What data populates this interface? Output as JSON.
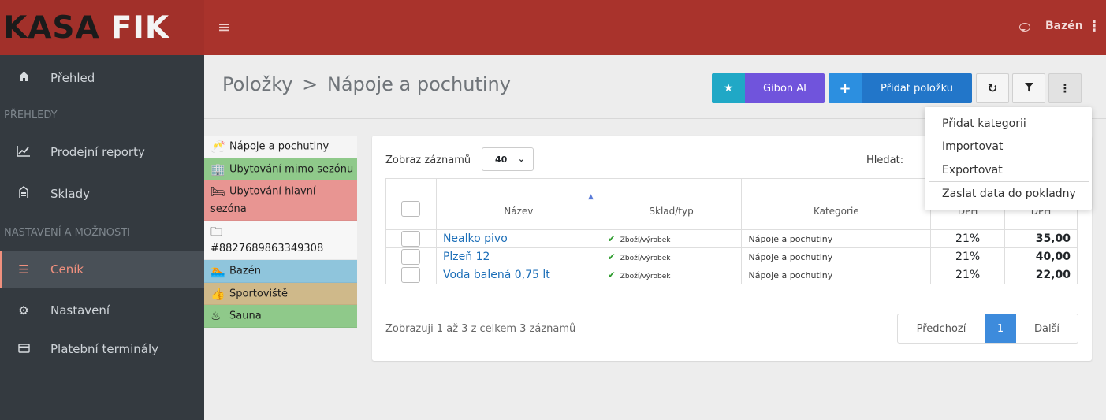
{
  "app": {
    "logo_a": "KASA",
    "logo_b": "FIK",
    "user": "Bazén"
  },
  "sidebar": {
    "items": [
      {
        "label": "Přehled",
        "icon": "home-icon"
      },
      {
        "label": "Prodejní reporty",
        "icon": "chart-icon"
      },
      {
        "label": "Sklady",
        "icon": "warehouse-icon"
      },
      {
        "label": "Ceník",
        "icon": "list-icon"
      },
      {
        "label": "Nastavení",
        "icon": "gear-icon"
      },
      {
        "label": "Platební terminály",
        "icon": "card-icon"
      }
    ],
    "section_prehledy": "PŘEHLEDY",
    "section_nastaveni": "NASTAVENÍ A MOŽNOSTI"
  },
  "breadcrumb": {
    "root": "Položky",
    "separator": ">",
    "current": "Nápoje a pochutiny"
  },
  "toolbar": {
    "gibon": "Gibon AI",
    "add": "Přidat položku"
  },
  "categories": [
    {
      "label": "Nápoje a pochutiny",
      "icon": "cheers-icon",
      "color": "#f5f5f5"
    },
    {
      "label": "Ubytování mimo sezónu",
      "icon": "building-icon",
      "color": "#8fc98a"
    },
    {
      "label": "Ubytování hlavní sezóna",
      "icon": "bed-icon",
      "color": "#e89592"
    },
    {
      "label": "#8827689863349308",
      "icon": "folder-icon",
      "color": "#f7f7f7"
    },
    {
      "label": "Bazén",
      "icon": "swimmer-icon",
      "color": "#8fc5dc"
    },
    {
      "label": "Sportoviště",
      "icon": "thumbs-up-icon",
      "color": "#cfb98a"
    },
    {
      "label": "Sauna",
      "icon": "sauna-icon",
      "color": "#8fc98a"
    }
  ],
  "table": {
    "length_label": "Zobraz záznamů",
    "length_value": "40",
    "search_label": "Hledat:",
    "columns": [
      "Název",
      "Sklad/typ",
      "Kategorie",
      "DPH",
      "DPH"
    ],
    "rows": [
      {
        "name": "Nealko pivo",
        "type": "Zboží/výrobek",
        "category": "Nápoje a pochutiny",
        "vat": "21%",
        "price": "35,00"
      },
      {
        "name": "Plzeň 12",
        "type": "Zboží/výrobek",
        "category": "Nápoje a pochutiny",
        "vat": "21%",
        "price": "40,00"
      },
      {
        "name": "Voda balená 0,75 lt",
        "type": "Zboží/výrobek",
        "category": "Nápoje a pochutiny",
        "vat": "21%",
        "price": "22,00"
      }
    ],
    "info": "Zobrazuji 1 až 3 z celkem 3 záznamů",
    "pager": {
      "prev": "Předchozí",
      "page": "1",
      "next": "Další"
    }
  },
  "dropdown": {
    "items": [
      "Přidat kategorii",
      "Importovat",
      "Exportovat",
      "Zaslat data do pokladny"
    ]
  }
}
